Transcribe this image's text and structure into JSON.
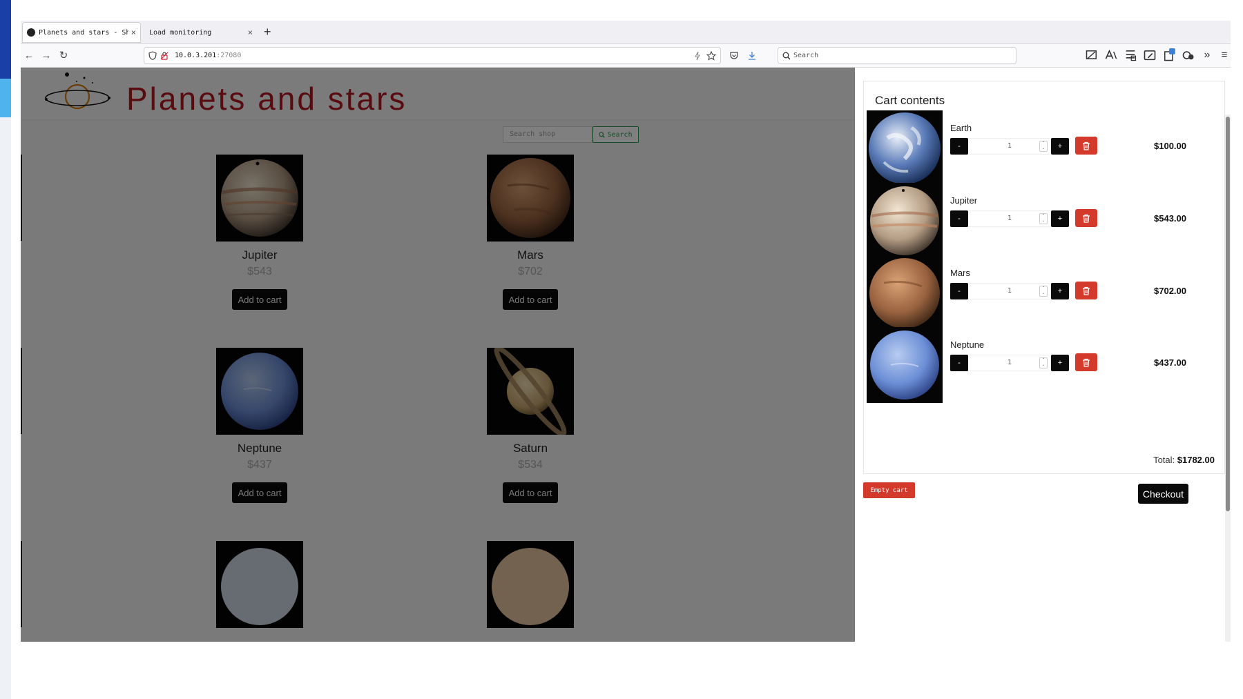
{
  "browser": {
    "tabs": [
      {
        "label": "Planets and stars - Shop",
        "close": "×"
      },
      {
        "label": "Load monitoring",
        "close": "×"
      }
    ],
    "new_tab": "+",
    "nav": {
      "back": "←",
      "forward": "→",
      "reload": "↻"
    },
    "url": {
      "host": "10.0.3.201",
      "port": ":27080"
    },
    "search_placeholder": "Search",
    "more_tools": "»",
    "menu": "≡"
  },
  "shop": {
    "title": "Planets and stars",
    "search_placeholder": "Search shop",
    "search_button": "Search",
    "add_to_cart_label": "Add to cart",
    "products": [
      {
        "name": "Jupiter",
        "price": "$543",
        "image": "jupiter"
      },
      {
        "name": "Mars",
        "price": "$702",
        "image": "mars"
      },
      {
        "name": "Neptune",
        "price": "$437",
        "image": "neptune"
      },
      {
        "name": "Saturn",
        "price": "$534",
        "image": "saturn"
      }
    ]
  },
  "cart": {
    "title": "Cart contents",
    "minus": "-",
    "plus": "+",
    "items": [
      {
        "name": "Earth",
        "qty": "1",
        "price": "$100.00",
        "image": "earth"
      },
      {
        "name": "Jupiter",
        "qty": "1",
        "price": "$543.00",
        "image": "jupiter"
      },
      {
        "name": "Mars",
        "qty": "1",
        "price": "$702.00",
        "image": "mars"
      },
      {
        "name": "Neptune",
        "qty": "1",
        "price": "$437.00",
        "image": "neptune"
      }
    ],
    "total_label": "Total:",
    "total_value": "$1782.00",
    "empty_button": "Empty cart",
    "checkout_button": "Checkout"
  },
  "colors": {
    "brand_red": "#b01820",
    "delete_red": "#d33a2c",
    "search_green": "#2e9a4d",
    "accent_blue": "#1a3fa6"
  }
}
